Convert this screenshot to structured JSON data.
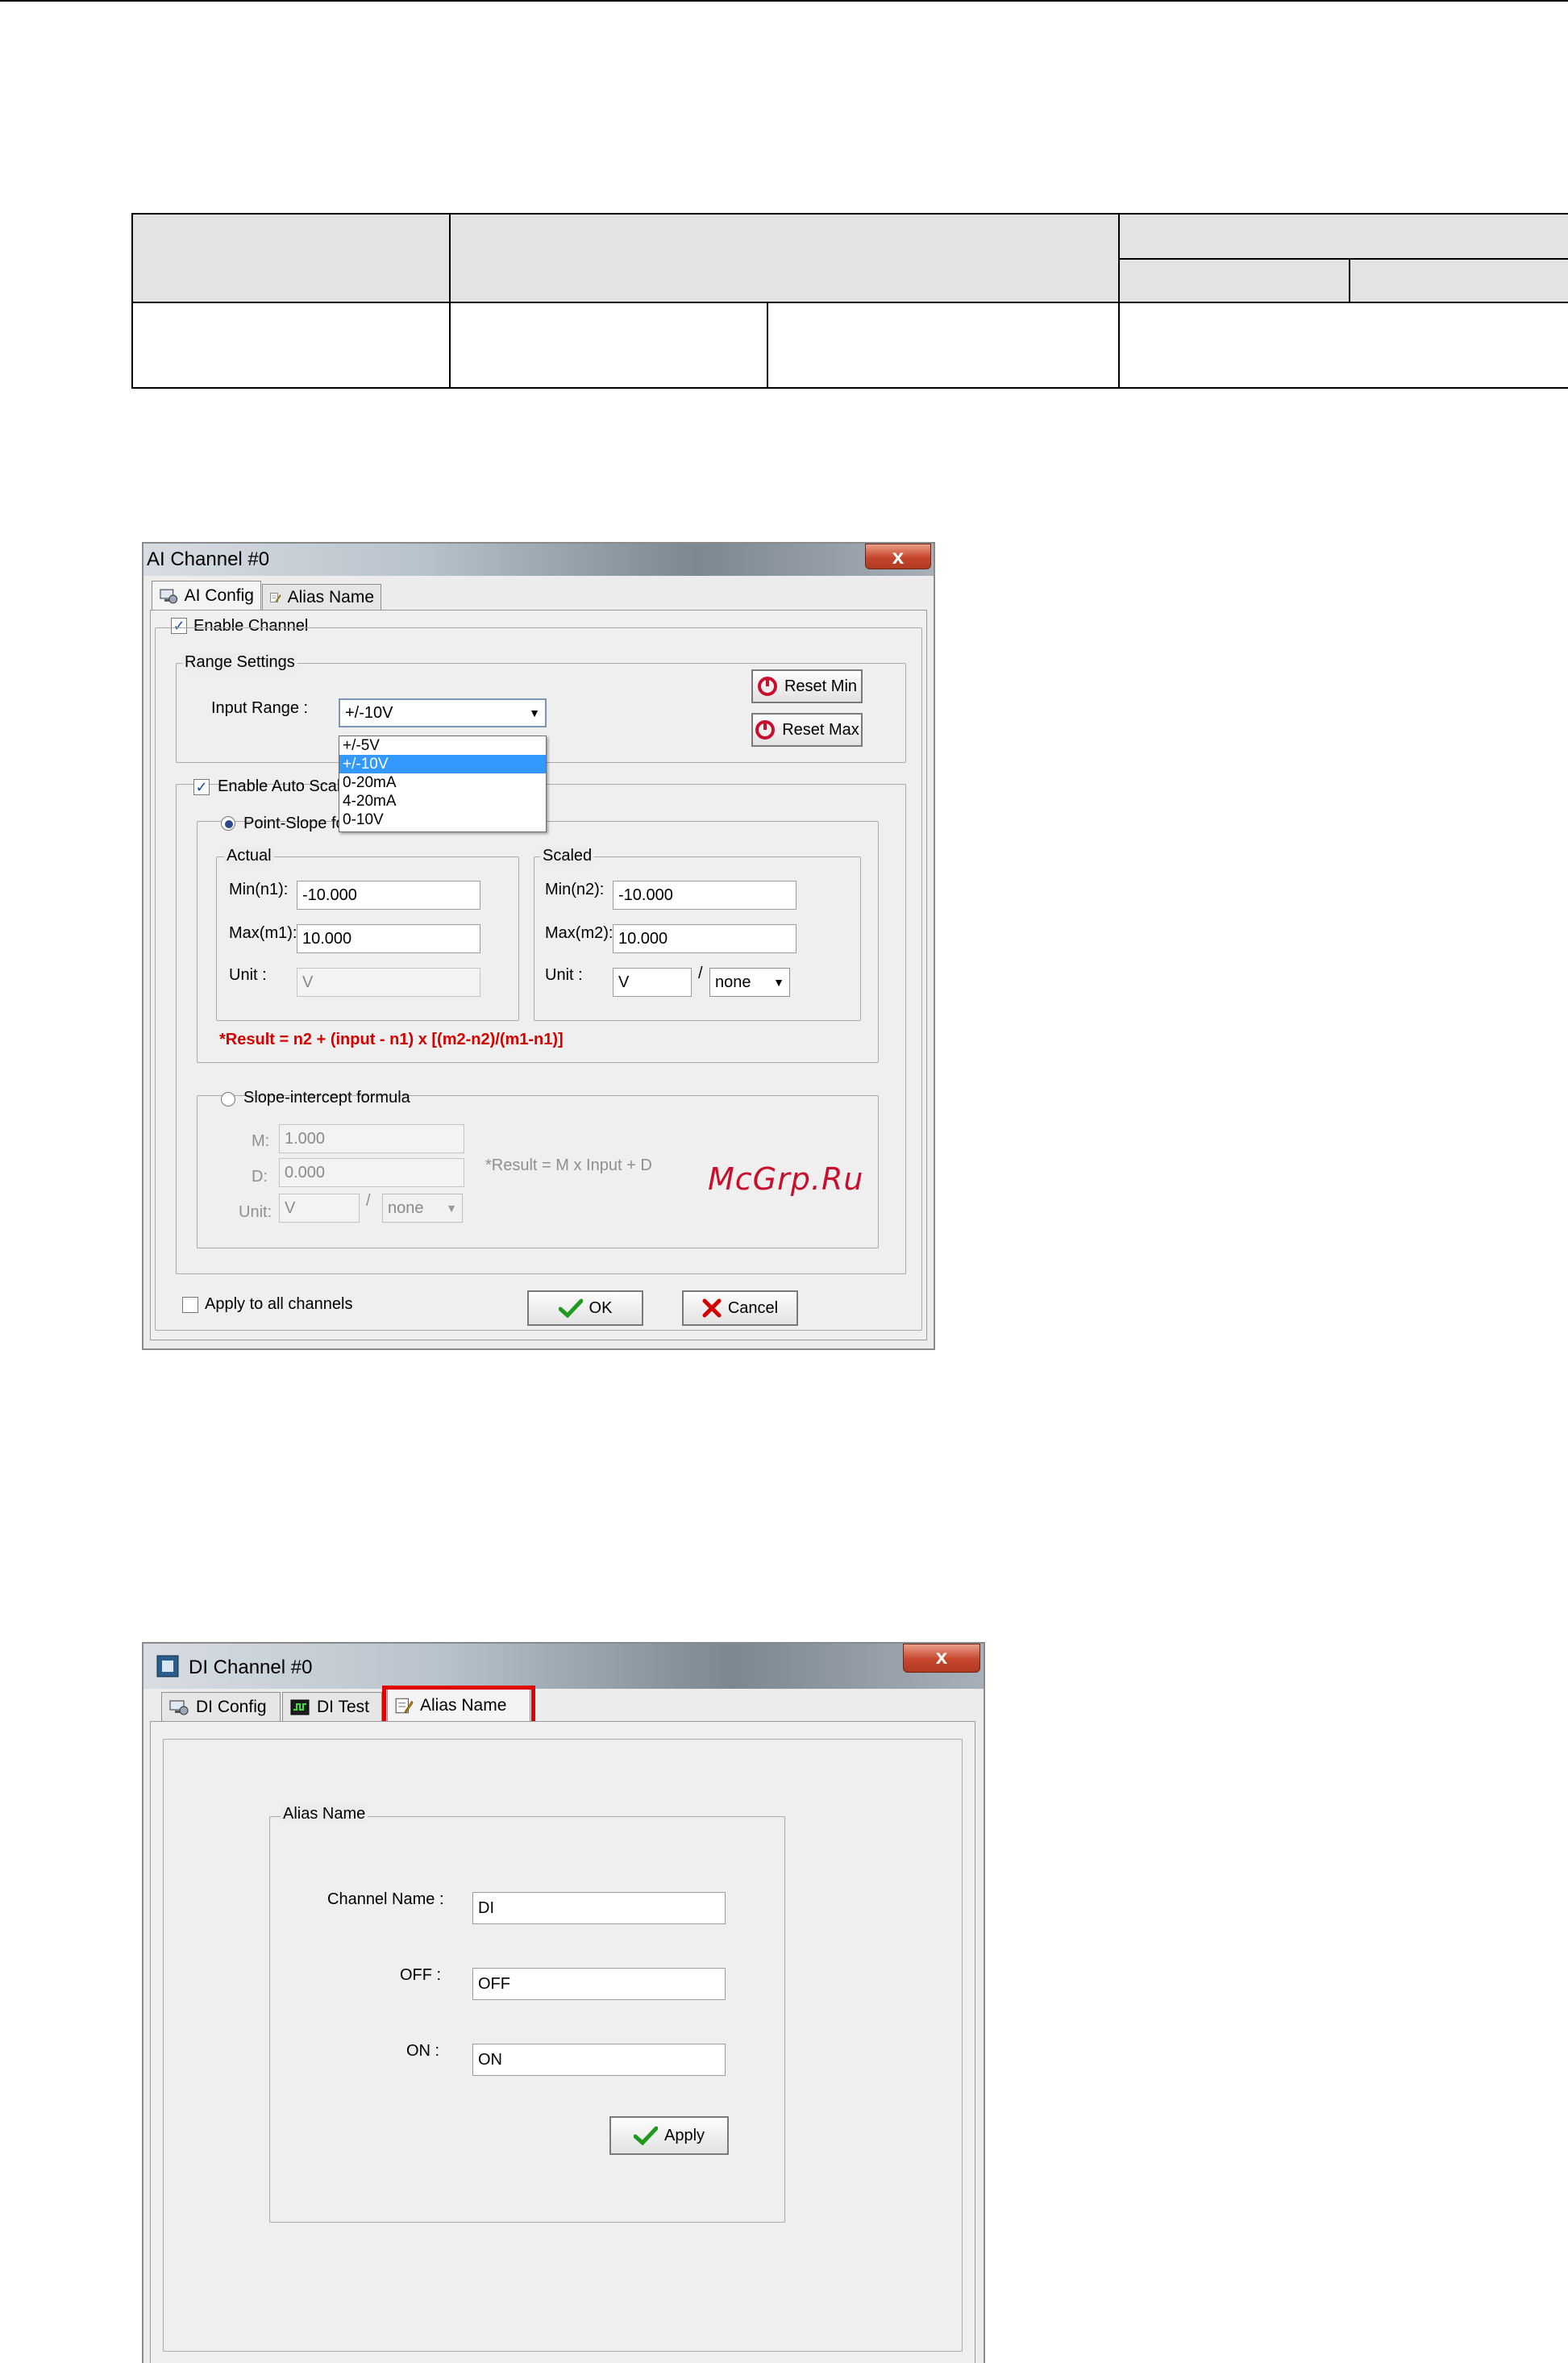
{
  "ai_dialog": {
    "title": "AI Channel #0",
    "close": "x",
    "tabs": [
      {
        "label": "AI Config",
        "icon": "config-icon"
      },
      {
        "label": "Alias Name",
        "icon": "alias-icon"
      }
    ],
    "enable_channel": {
      "label": "Enable Channel",
      "checked": true
    },
    "range_settings": {
      "legend": "Range Settings",
      "input_range_label": "Input Range :",
      "input_range_value": "+/-10V",
      "options": [
        "+/-5V",
        "+/-10V",
        "0-20mA",
        "4-20mA",
        "0-10V"
      ],
      "selected_index": 1,
      "reset_min": "Reset Min",
      "reset_max": "Reset Max"
    },
    "auto_scaling": {
      "label": "Enable Auto Scali",
      "checked": true
    },
    "point_slope": {
      "label": "Point-Slope formula",
      "selected": true,
      "actual": {
        "legend": "Actual",
        "min_label": "Min(n1):",
        "min_value": "-10.000",
        "max_label": "Max(m1):",
        "max_value": "10.000",
        "unit_label": "Unit :",
        "unit_value": "V"
      },
      "scaled": {
        "legend": "Scaled",
        "min_label": "Min(n2):",
        "min_value": "-10.000",
        "max_label": "Max(m2):",
        "max_value": "10.000",
        "unit_label": "Unit :",
        "unit_value": "V",
        "divider": "/",
        "unit_select": "none"
      },
      "formula": "*Result = n2 + (input - n1) x [(m2-n2)/(m1-n1)]"
    },
    "slope_intercept": {
      "label": "Slope-intercept formula",
      "selected": false,
      "m_label": "M:",
      "m_value": "1.000",
      "d_label": "D:",
      "d_value": "0.000",
      "unit_label": "Unit:",
      "unit_value": "V",
      "divider": "/",
      "unit_select": "none",
      "formula": "*Result = M x Input + D"
    },
    "watermark": "McGrp.Ru",
    "apply_all": {
      "label": "Apply to all channels",
      "checked": false
    },
    "ok": "OK",
    "cancel": "Cancel"
  },
  "di_dialog": {
    "title": "DI Channel #0",
    "close": "x",
    "tabs": [
      {
        "label": "DI Config",
        "icon": "config-icon"
      },
      {
        "label": "DI Test",
        "icon": "test-icon"
      },
      {
        "label": "Alias Name",
        "icon": "alias-icon"
      }
    ],
    "alias_group": {
      "legend": "Alias Name",
      "channel_label": "Channel Name :",
      "channel_value": "DI",
      "off_label": "OFF :",
      "off_value": "OFF",
      "on_label": "ON :",
      "on_value": "ON",
      "apply": "Apply"
    }
  },
  "colors": {
    "highlight": "#e00000",
    "formula": "#d40000",
    "selection": "#3399ff"
  }
}
